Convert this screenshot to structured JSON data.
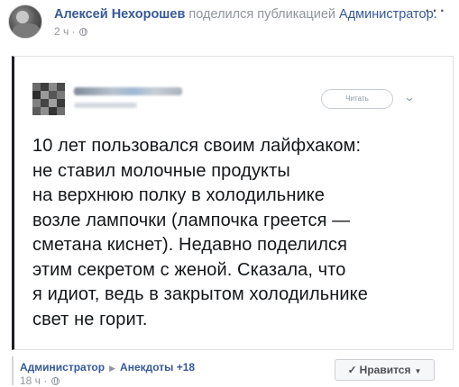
{
  "post": {
    "author": "Алексей Нехорошев",
    "shared_text": "поделился публикацией",
    "shared_page": "Администратор.",
    "time": "2 ч",
    "separator": " · ",
    "more": "···"
  },
  "tweet": {
    "follow_label": "Читать",
    "text": "10 лет пользовался своим лайфхаком:\nне ставил молочные продукты\nна верхнюю полку в холодильнике\nвозле лампочки (лампочка греется —\nсметана киснет). Недавно поделился\nэтим секретом с женой. Сказала, что\nя идиот, ведь в закрытом холодильнике\nсвет не горит."
  },
  "footer": {
    "page": "Администратор",
    "group": "Анекдоты +18",
    "time": "18 ч",
    "separator": " · ",
    "like_label": "Нравится"
  },
  "icons": {
    "globe": "globe-icon",
    "check": "checkmark-icon",
    "caret": "caret-down-icon",
    "breadcrumb_arrow": "triangle-right-icon"
  },
  "colors": {
    "link": "#365899",
    "meta": "#90949c",
    "text": "#1d2129"
  }
}
